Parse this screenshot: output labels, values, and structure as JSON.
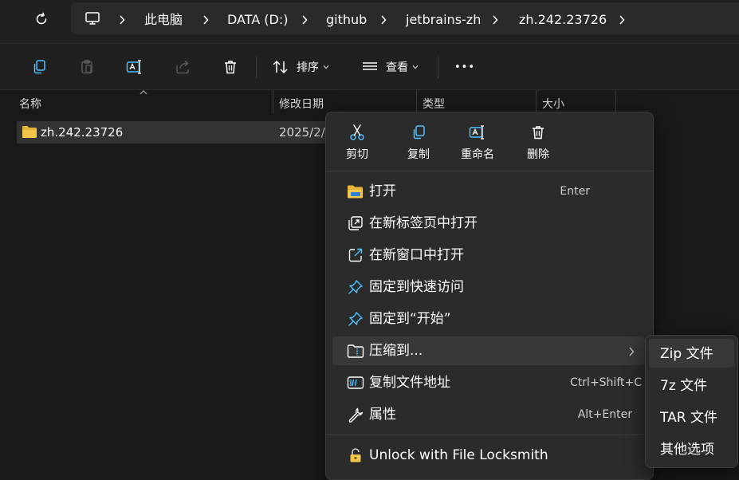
{
  "breadcrumb": {
    "items": [
      "此电脑",
      "DATA (D:)",
      "github",
      "jetbrains-zh",
      "zh.242.23726"
    ]
  },
  "toolbar": {
    "sort_label": "排序",
    "view_label": "查看",
    "more_label": "•••"
  },
  "columns": {
    "name": "名称",
    "modified": "修改日期",
    "type": "类型",
    "size": "大小"
  },
  "files": [
    {
      "name": "zh.242.23726",
      "modified": "2025/2/"
    }
  ],
  "context_menu": {
    "quick_actions": [
      "剪切",
      "复制",
      "重命名",
      "删除"
    ],
    "items": [
      {
        "label": "打开",
        "shortcut": "Enter",
        "icon": "folder-open-icon"
      },
      {
        "label": "在新标签页中打开",
        "shortcut": "",
        "icon": "new-tab-icon"
      },
      {
        "label": "在新窗口中打开",
        "shortcut": "",
        "icon": "new-window-icon"
      },
      {
        "label": "固定到快速访问",
        "shortcut": "",
        "icon": "pin-icon"
      },
      {
        "label": "固定到“开始”",
        "shortcut": "",
        "icon": "pin-icon"
      },
      {
        "label": "压缩到...",
        "shortcut": "",
        "icon": "archive-icon"
      },
      {
        "label": "复制文件地址",
        "shortcut": "Ctrl+Shift+C",
        "icon": "copy-path-icon"
      },
      {
        "label": "属性",
        "shortcut": "Alt+Enter",
        "icon": "wrench-icon"
      },
      {
        "label": "Unlock with File Locksmith",
        "shortcut": "",
        "icon": "lock-icon"
      }
    ]
  },
  "submenu": {
    "items": [
      "Zip 文件",
      "7z 文件",
      "TAR 文件",
      "其他选项"
    ]
  },
  "colors": {
    "accent": "#4cc2ff",
    "folder": "#f3c64b",
    "background": "#191919",
    "menu": "#2b2b2b"
  }
}
